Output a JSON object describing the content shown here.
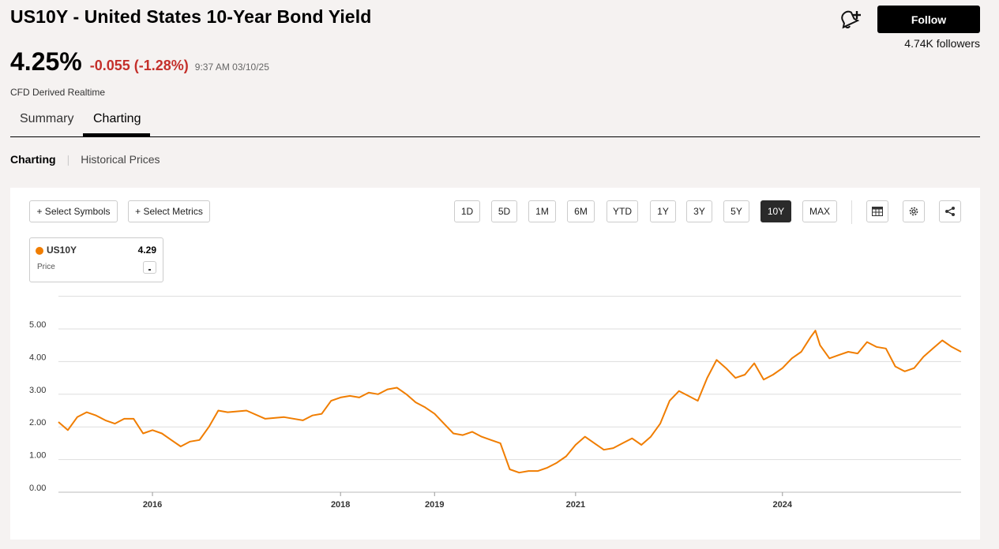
{
  "header": {
    "title": "US10Y - United States 10-Year Bond Yield",
    "follow_label": "Follow",
    "followers": "4.74K followers",
    "bell_icon": "bell-plus-icon"
  },
  "quote": {
    "price": "4.25%",
    "change": "-0.055 (-1.28%)",
    "time": "9:37 AM 03/10/25",
    "note": "CFD Derived Realtime",
    "change_color": "#c4302b"
  },
  "tabs": [
    {
      "label": "Summary",
      "active": false
    },
    {
      "label": "Charting",
      "active": true
    }
  ],
  "subnav": {
    "active": "Charting",
    "separator": "|",
    "link": "Historical Prices"
  },
  "toolbar": {
    "select_symbols": "+ Select Symbols",
    "select_metrics": "+ Select Metrics",
    "ranges": [
      "1D",
      "5D",
      "1M",
      "6M",
      "YTD",
      "1Y",
      "3Y",
      "5Y",
      "10Y",
      "MAX"
    ],
    "active_range": "10Y",
    "icons": [
      "table-icon",
      "gear-icon",
      "share-icon"
    ]
  },
  "legend": {
    "symbol": "US10Y",
    "value": "4.29",
    "metric": "Price",
    "color": "#f07d00"
  },
  "chart_data": {
    "type": "line",
    "y_ticks": [
      "5.00",
      "4.00",
      "3.00",
      "2.00",
      "1.00",
      "0.00"
    ],
    "x_ticks": [
      "2016",
      "2018",
      "2019",
      "2021",
      "2024"
    ],
    "ylim": [
      0,
      6
    ],
    "grid": true,
    "series": [
      {
        "color": "#f07d00",
        "points": [
          [
            2015.2,
            2.15
          ],
          [
            2015.3,
            1.9
          ],
          [
            2015.4,
            2.3
          ],
          [
            2015.5,
            2.45
          ],
          [
            2015.6,
            2.35
          ],
          [
            2015.7,
            2.2
          ],
          [
            2015.8,
            2.1
          ],
          [
            2015.9,
            2.25
          ],
          [
            2016.0,
            2.25
          ],
          [
            2016.1,
            1.8
          ],
          [
            2016.2,
            1.9
          ],
          [
            2016.3,
            1.8
          ],
          [
            2016.4,
            1.6
          ],
          [
            2016.5,
            1.4
          ],
          [
            2016.6,
            1.55
          ],
          [
            2016.7,
            1.6
          ],
          [
            2016.8,
            2.0
          ],
          [
            2016.9,
            2.5
          ],
          [
            2017.0,
            2.45
          ],
          [
            2017.2,
            2.5
          ],
          [
            2017.4,
            2.25
          ],
          [
            2017.6,
            2.3
          ],
          [
            2017.8,
            2.2
          ],
          [
            2017.9,
            2.35
          ],
          [
            2018.0,
            2.4
          ],
          [
            2018.1,
            2.8
          ],
          [
            2018.2,
            2.9
          ],
          [
            2018.3,
            2.95
          ],
          [
            2018.4,
            2.9
          ],
          [
            2018.5,
            3.05
          ],
          [
            2018.6,
            3.0
          ],
          [
            2018.7,
            3.15
          ],
          [
            2018.8,
            3.2
          ],
          [
            2018.9,
            3.0
          ],
          [
            2019.0,
            2.75
          ],
          [
            2019.1,
            2.6
          ],
          [
            2019.2,
            2.4
          ],
          [
            2019.3,
            2.1
          ],
          [
            2019.4,
            1.8
          ],
          [
            2019.5,
            1.75
          ],
          [
            2019.6,
            1.85
          ],
          [
            2019.7,
            1.7
          ],
          [
            2019.8,
            1.6
          ],
          [
            2019.9,
            1.5
          ],
          [
            2020.0,
            0.7
          ],
          [
            2020.1,
            0.6
          ],
          [
            2020.2,
            0.65
          ],
          [
            2020.3,
            0.65
          ],
          [
            2020.4,
            0.75
          ],
          [
            2020.5,
            0.9
          ],
          [
            2020.6,
            1.1
          ],
          [
            2020.7,
            1.45
          ],
          [
            2020.8,
            1.7
          ],
          [
            2020.9,
            1.5
          ],
          [
            2021.0,
            1.3
          ],
          [
            2021.1,
            1.35
          ],
          [
            2021.2,
            1.5
          ],
          [
            2021.3,
            1.65
          ],
          [
            2021.4,
            1.45
          ],
          [
            2021.5,
            1.7
          ],
          [
            2021.6,
            2.1
          ],
          [
            2021.7,
            2.8
          ],
          [
            2021.8,
            3.1
          ],
          [
            2021.9,
            2.95
          ],
          [
            2022.0,
            2.8
          ],
          [
            2022.1,
            3.5
          ],
          [
            2022.2,
            4.05
          ],
          [
            2022.3,
            3.8
          ],
          [
            2022.4,
            3.5
          ],
          [
            2022.5,
            3.6
          ],
          [
            2022.6,
            3.95
          ],
          [
            2022.7,
            3.45
          ],
          [
            2022.8,
            3.6
          ],
          [
            2022.9,
            3.8
          ],
          [
            2023.0,
            4.1
          ],
          [
            2023.1,
            4.3
          ],
          [
            2023.2,
            4.75
          ],
          [
            2023.25,
            4.95
          ],
          [
            2023.3,
            4.5
          ],
          [
            2023.4,
            4.1
          ],
          [
            2023.5,
            4.2
          ],
          [
            2023.6,
            4.3
          ],
          [
            2023.7,
            4.25
          ],
          [
            2023.8,
            4.6
          ],
          [
            2023.9,
            4.45
          ],
          [
            2024.0,
            4.4
          ],
          [
            2024.1,
            3.85
          ],
          [
            2024.2,
            3.7
          ],
          [
            2024.3,
            3.8
          ],
          [
            2024.4,
            4.15
          ],
          [
            2024.5,
            4.4
          ],
          [
            2024.6,
            4.65
          ],
          [
            2024.7,
            4.45
          ],
          [
            2024.8,
            4.3
          ]
        ]
      }
    ]
  }
}
